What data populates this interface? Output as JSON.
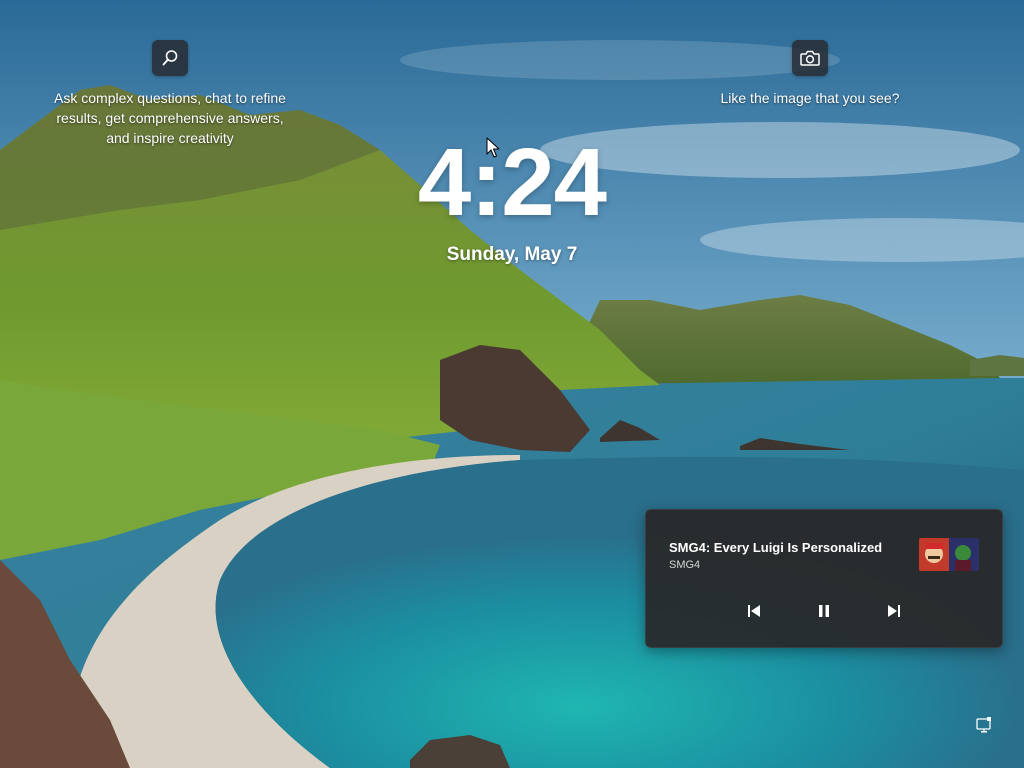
{
  "widgets": {
    "left": {
      "icon": "search-icon",
      "line1": "Ask complex questions, chat to refine",
      "line2": "results, get comprehensive answers,",
      "line3": "and inspire creativity"
    },
    "right": {
      "icon": "camera-icon",
      "text": "Like the image that you see?"
    }
  },
  "lock_screen": {
    "time": "4:24",
    "date": "Sunday, May 7"
  },
  "media": {
    "title": "SMG4: Every Luigi Is Personalized",
    "artist": "SMG4",
    "thumbnail": "video-thumbnail",
    "controls": {
      "previous": "previous-track-icon",
      "pause": "pause-icon",
      "next": "next-track-icon"
    }
  },
  "status": {
    "network_icon": "network-icon"
  },
  "colors": {
    "sky_top": "#2e6f9c",
    "sea": "#1f9fa8",
    "media_card_bg": "#2a2a2a",
    "text": "#ffffff"
  }
}
